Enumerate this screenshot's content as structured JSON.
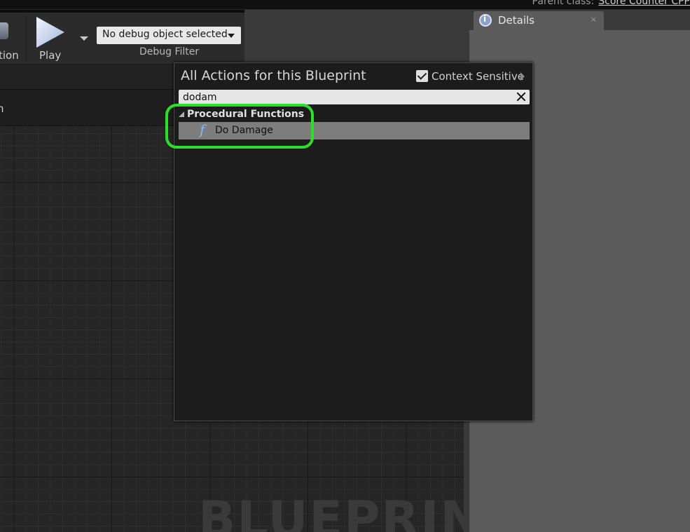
{
  "window": {
    "parent_class_label": "Parent class:",
    "parent_class_value": "Score Counter CPP"
  },
  "toolbar": {
    "left_button_label_partial": "tion",
    "play_label": "Play",
    "debug_object_value": "No debug object selected",
    "debug_filter_label": "Debug Filter"
  },
  "graph": {
    "tab_label_partial": "n",
    "watermark": "BLUEPRINT"
  },
  "details": {
    "tab_label": "Details",
    "close_glyph": "×"
  },
  "action_menu": {
    "title": "All Actions for this Blueprint",
    "context_sensitive_label": "Context Sensitive",
    "context_sensitive_checked": true,
    "search_value": "dodam",
    "category": "Procedural Functions",
    "items": [
      {
        "icon": "function-icon",
        "glyph": "f",
        "label": "Do Damage",
        "selected": true
      }
    ]
  },
  "annotation": {
    "highlight_color": "#2ae02a"
  }
}
